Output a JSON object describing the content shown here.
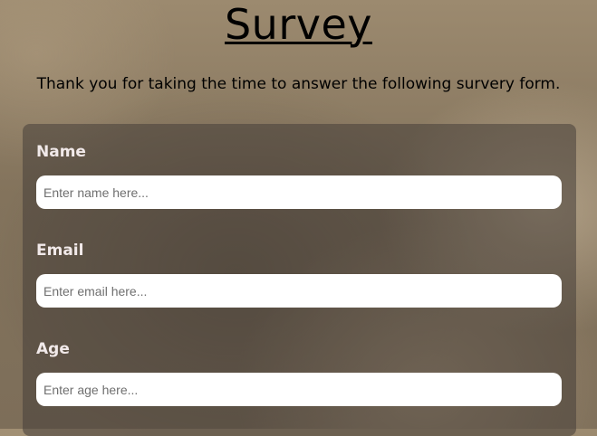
{
  "header": {
    "title": "Survey",
    "description": "Thank you for taking the time to answer the following survery form."
  },
  "form": {
    "fields": [
      {
        "label": "Name",
        "placeholder": "Enter name here...",
        "value": ""
      },
      {
        "label": "Email",
        "placeholder": "Enter email here...",
        "value": ""
      },
      {
        "label": "Age",
        "placeholder": "Enter age here...",
        "value": ""
      }
    ]
  }
}
